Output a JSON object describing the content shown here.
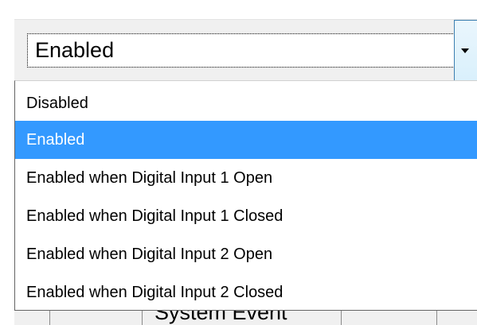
{
  "combo": {
    "selected_value": "Enabled",
    "arrow_icon": "chevron-down-icon"
  },
  "dropdown": {
    "options": [
      {
        "label": "Disabled",
        "selected": false
      },
      {
        "label": "Enabled",
        "selected": true
      },
      {
        "label": "Enabled when Digital Input 1 Open",
        "selected": false
      },
      {
        "label": "Enabled when Digital Input 1 Closed",
        "selected": false
      },
      {
        "label": "Enabled when Digital Input 2 Open",
        "selected": false
      },
      {
        "label": "Enabled when Digital Input 2 Closed",
        "selected": false
      }
    ]
  },
  "background_table": {
    "cell_text": "System Event"
  },
  "colors": {
    "selection": "#3399ff",
    "panel": "#f0f0f0",
    "arrow_button": "#d9f0fc"
  }
}
